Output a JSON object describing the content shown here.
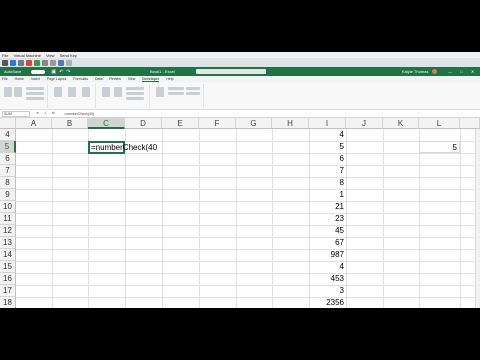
{
  "vm_menu": [
    "File",
    "Virtual Machine",
    "View",
    "Send Key"
  ],
  "excel": {
    "autosave_label": "AutoSave",
    "title": "Book1 - Excel",
    "user": "Kaiyle Thomas",
    "tabs": [
      "File",
      "Home",
      "Insert",
      "Page Layout",
      "Formulas",
      "Data",
      "Review",
      "View",
      "Developer",
      "Help"
    ],
    "active_tab": "Developer",
    "name_box": "SUM",
    "formula_bar": "=numberCheck(40)"
  },
  "columns": [
    "A",
    "B",
    "C",
    "D",
    "E",
    "F",
    "G",
    "H",
    "I",
    "J",
    "K",
    "L"
  ],
  "rows": [
    "4",
    "5",
    "6",
    "7",
    "8",
    "9",
    "10",
    "11",
    "12",
    "13",
    "14",
    "15",
    "16",
    "17",
    "18"
  ],
  "column_i_values": [
    "4",
    "5",
    "6",
    "7",
    "8",
    "1",
    "21",
    "23",
    "45",
    "67",
    "987",
    "4",
    "453",
    "3",
    "2356"
  ],
  "active_cell": {
    "ref": "C5",
    "text": "=numberCheck(40"
  },
  "l5_value": "5",
  "colors": {
    "excel_green": "#217346",
    "vm_toolbar": "#dfe3e8"
  }
}
